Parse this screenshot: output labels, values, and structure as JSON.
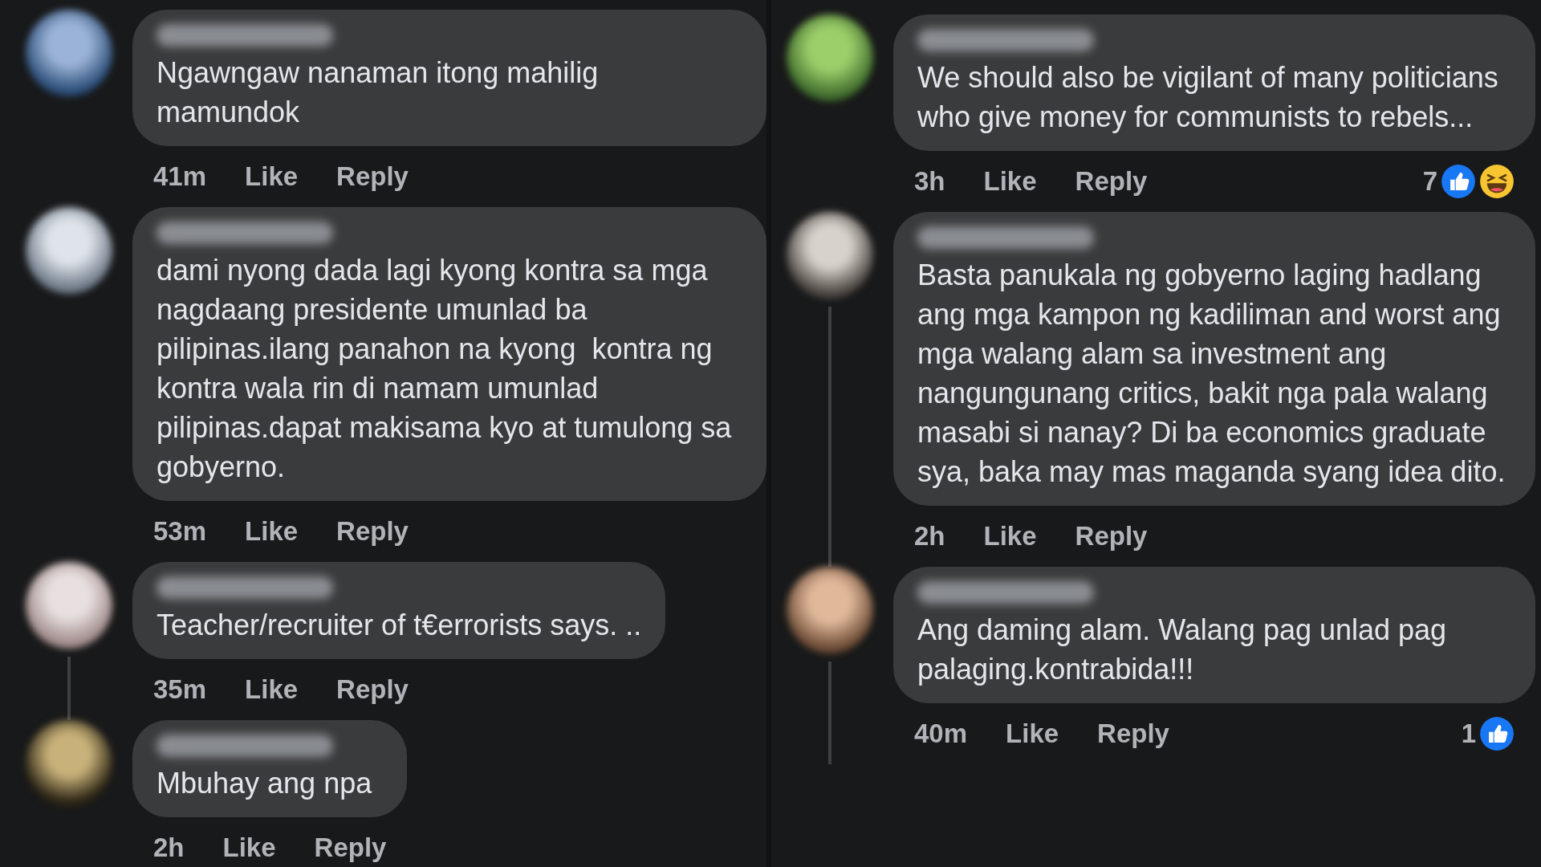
{
  "columns": [
    {
      "comments": [
        {
          "text": "Ngawngaw nanaman itong mahilig mamundok",
          "time": "41m",
          "like": "Like",
          "reply": "Reply",
          "thread_line": false
        },
        {
          "text": "dami nyong dada lagi kyong kontra sa mga nagdaang presidente umunlad ba pilipinas.ilang panahon na kyong  kontra ng kontra wala rin di namam umunlad pilipinas.dapat makisama kyo at tumulong sa gobyerno.",
          "time": "53m",
          "like": "Like",
          "reply": "Reply",
          "thread_line": false
        },
        {
          "text": "Teacher/recruiter of t€errorists says. ..",
          "time": "35m",
          "like": "Like",
          "reply": "Reply",
          "thread_line": true
        },
        {
          "text": "Mbuhay ang npa",
          "time": "2h",
          "like": "Like",
          "reply": "Reply",
          "thread_line": false
        }
      ]
    },
    {
      "comments": [
        {
          "text": "We should also be vigilant of many politicians who give money for communists to rebels...",
          "time": "3h",
          "like": "Like",
          "reply": "Reply",
          "thread_line": false,
          "reactions": {
            "count": "7",
            "icons": [
              {
                "kind": "like"
              },
              {
                "kind": "haha"
              }
            ]
          }
        },
        {
          "text": "Basta panukala ng gobyerno laging hadlang ang mga kampon ng kadiliman and worst ang mga walang alam sa investment ang nangungunang critics, bakit nga pala walang masabi si nanay? Di ba economics graduate sya, baka may mas maganda syang idea dito.",
          "time": "2h",
          "like": "Like",
          "reply": "Reply",
          "thread_line": true
        },
        {
          "text": "Ang daming alam. Walang pag unlad pag palaging.kontrabida!!!",
          "time": "40m",
          "like": "Like",
          "reply": "Reply",
          "thread_line": true,
          "reactions": {
            "count": "1",
            "icons": [
              {
                "kind": "like"
              }
            ]
          }
        }
      ]
    }
  ]
}
